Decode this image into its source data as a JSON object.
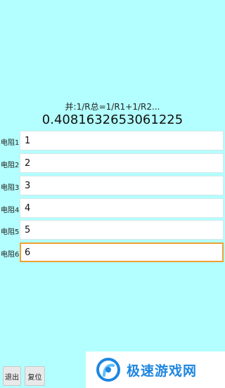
{
  "formula": "并:1/R总=1/R1+1/R2...",
  "result": "0.4081632653061225",
  "resistors": [
    {
      "label": "电阻1:",
      "value": "1"
    },
    {
      "label": "电阻2:",
      "value": "2"
    },
    {
      "label": "电阻3:",
      "value": "3"
    },
    {
      "label": "电阻4:",
      "value": "4"
    },
    {
      "label": "电阻5:",
      "value": "5"
    },
    {
      "label": "电阻6:",
      "value": "6"
    }
  ],
  "buttons": {
    "exit": "退出",
    "reset": "复位"
  },
  "watermark": {
    "text": "极速游戏网",
    "icon": "swirl-logo-icon"
  },
  "colors": {
    "background": "#b3ffff",
    "focus_border": "#f0a030",
    "watermark_text": "#1e86e0"
  }
}
